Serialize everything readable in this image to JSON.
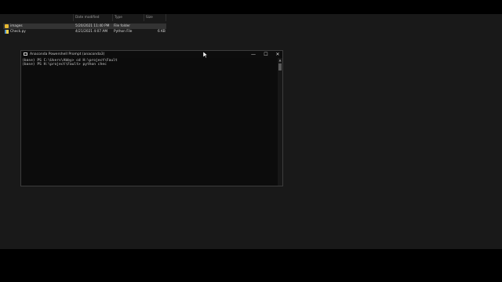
{
  "explorer": {
    "columns": [
      "Date modified",
      "Type",
      "Size"
    ],
    "files": [
      {
        "name": "images",
        "date": "5/20/2021 11:40 PM",
        "type": "File folder",
        "size": "",
        "icon": "folder-icon"
      },
      {
        "name": "Check.py",
        "date": "4/21/2021 4:07 AM",
        "type": "Python File",
        "size": "6 KB",
        "icon": "python-file-icon"
      }
    ]
  },
  "terminal": {
    "title": "Anaconda Powershell Prompt (anaconda3)",
    "lines": [
      "(base) PS C:\\Users\\Abby> cd H:\\project\\Fault",
      "(base) PS H:\\project\\Fault> python chec"
    ],
    "controls": {
      "minimize": "—",
      "maximize": "☐",
      "close": "✕"
    }
  }
}
